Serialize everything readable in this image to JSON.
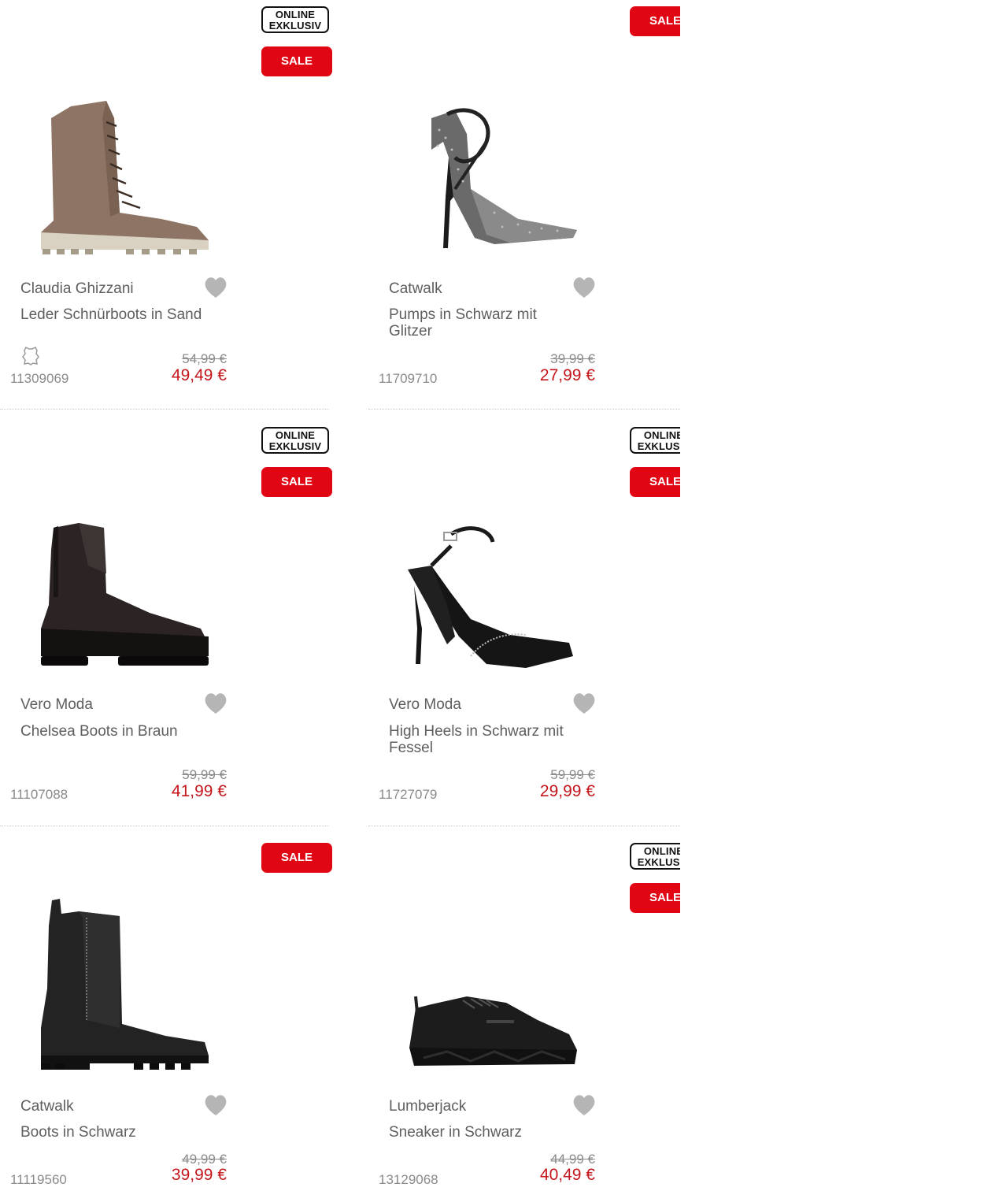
{
  "badges": {
    "online": "ONLINE EXKLUSIV",
    "online_line1": "ONLINE",
    "online_line2": "EXKLUSIV",
    "sale": "SALE"
  },
  "products": [
    {
      "brand": "Claudia Ghizzani",
      "name": "Leder Schnürboots in Sand",
      "old_price": "54,99 €",
      "price": "49,49 €",
      "article": "11309069",
      "online_exclusive": true,
      "sale": true,
      "leather_icon": true
    },
    {
      "brand": "Catwalk",
      "name": "Pumps in Schwarz mit Glitzer",
      "old_price": "39,99 €",
      "price": "27,99 €",
      "article": "11709710",
      "online_exclusive": false,
      "sale": true,
      "leather_icon": false
    },
    {
      "brand": "Vero Moda",
      "name": "Chelsea Boots in Braun",
      "old_price": "59,99 €",
      "price": "41,99 €",
      "article": "11107088",
      "online_exclusive": true,
      "sale": true,
      "leather_icon": false
    },
    {
      "brand": "Vero Moda",
      "name": "High Heels in Schwarz mit Fessel",
      "old_price": "59,99 €",
      "price": "29,99 €",
      "article": "11727079",
      "online_exclusive": true,
      "sale": true,
      "leather_icon": false
    },
    {
      "brand": "Catwalk",
      "name": "Boots in Schwarz",
      "old_price": "49,99 €",
      "price": "39,99 €",
      "article": "11119560",
      "online_exclusive": false,
      "sale": true,
      "leather_icon": false
    },
    {
      "brand": "Lumberjack",
      "name": "Sneaker in Schwarz",
      "old_price": "44,99 €",
      "price": "40,49 €",
      "article": "13129068",
      "online_exclusive": true,
      "sale": true,
      "leather_icon": false
    }
  ],
  "icons": {
    "wishlist": "heart-icon",
    "material": "leather-icon"
  },
  "colors": {
    "sale": "#e10613",
    "price": "#c4161c",
    "heart": "#b5b5b5"
  }
}
